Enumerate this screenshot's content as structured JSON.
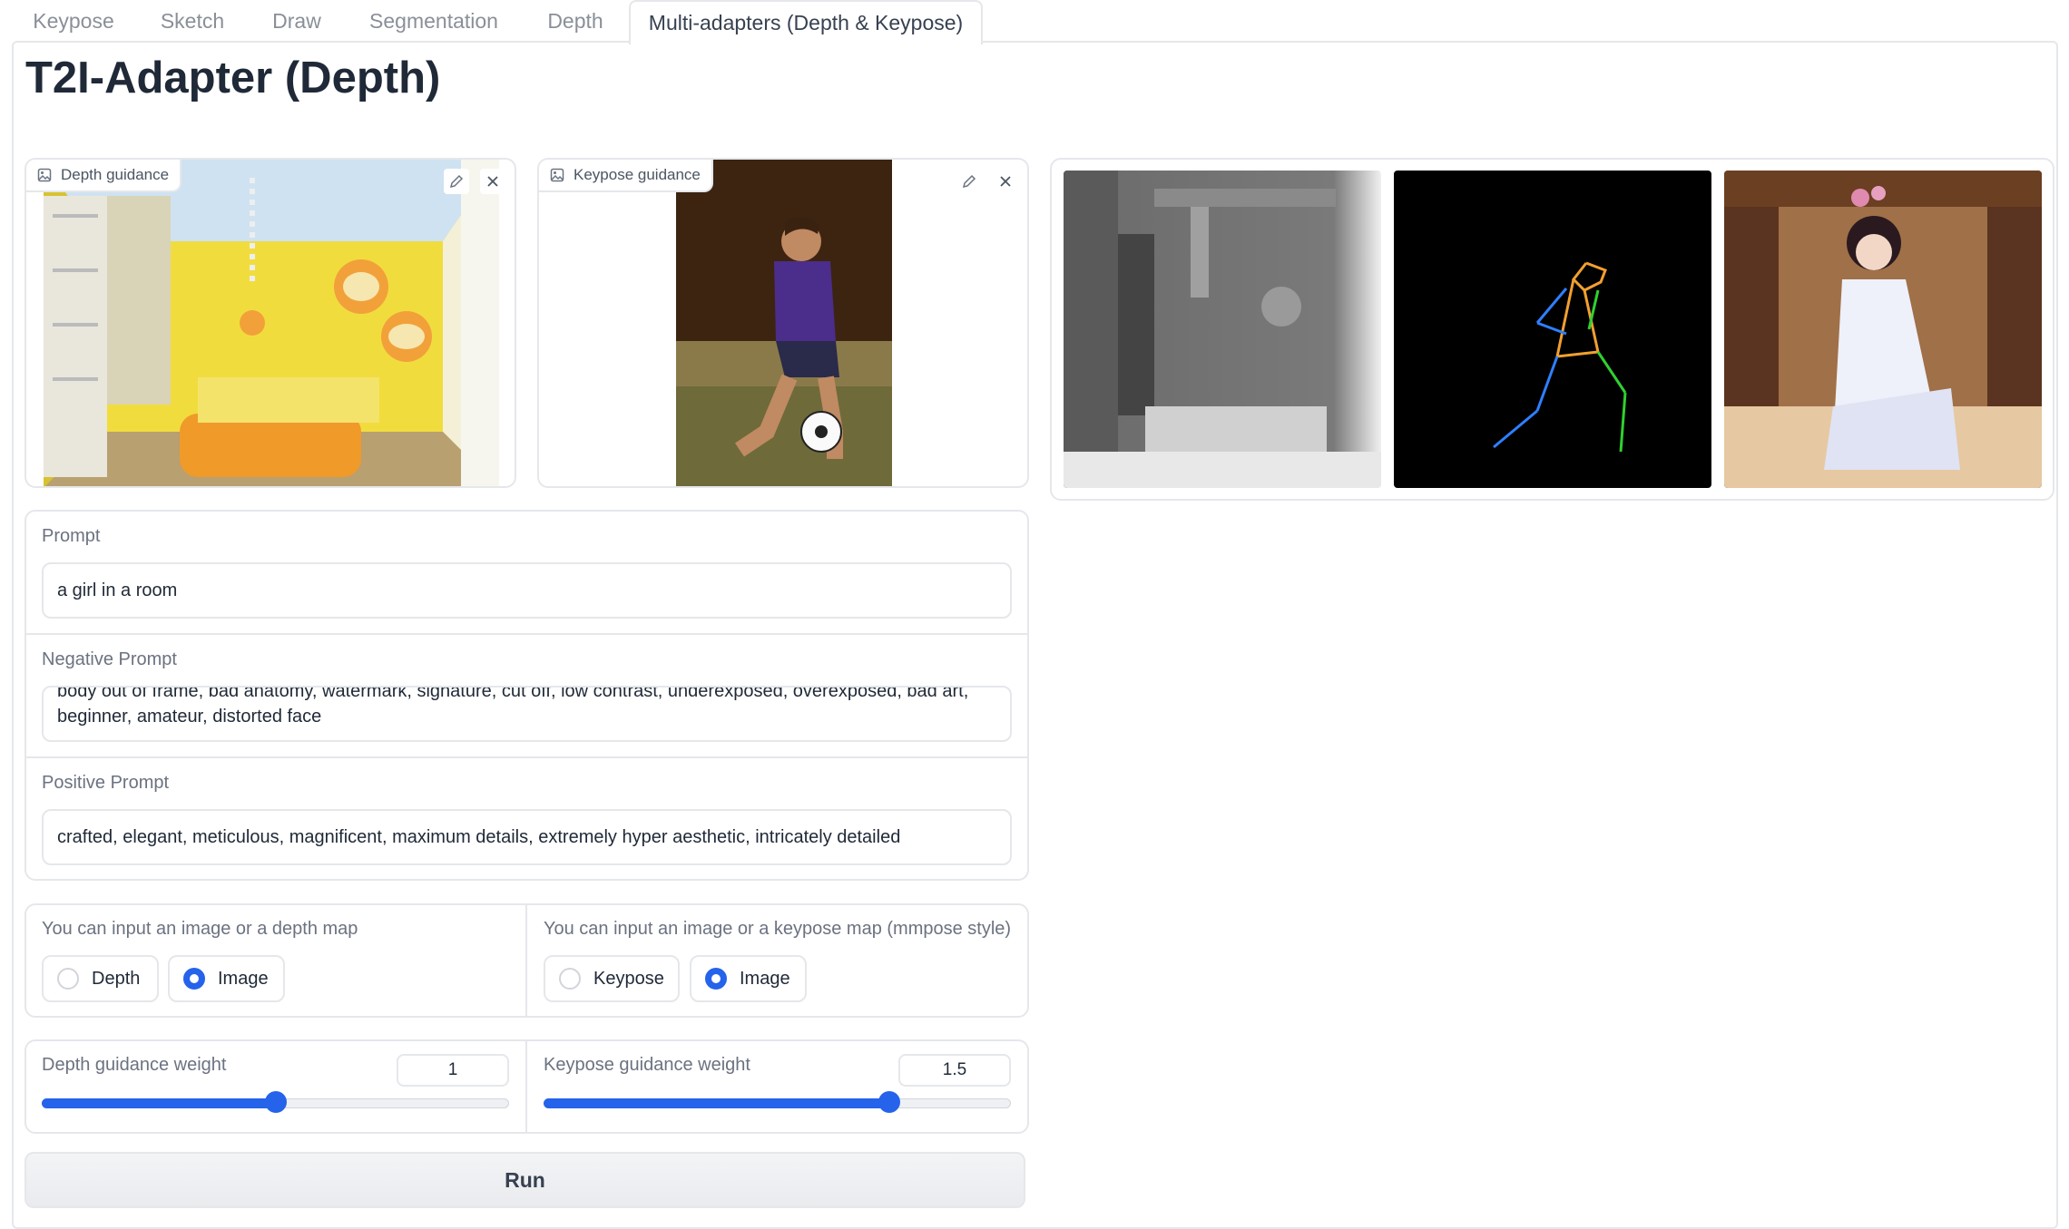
{
  "tabs": [
    "Keypose",
    "Sketch",
    "Draw",
    "Segmentation",
    "Depth",
    "Multi-adapters (Depth & Keypose)"
  ],
  "title": "T2I-Adapter (Depth)",
  "depth_image": {
    "label": "Depth guidance"
  },
  "keypose_image": {
    "label": "Keypose guidance"
  },
  "prompt": {
    "label": "Prompt",
    "value": "a girl in a room"
  },
  "negative_prompt": {
    "label": "Negative Prompt",
    "line1": "body out of frame, bad anatomy, watermark, signature, cut off, low contrast, underexposed, overexposed, bad art,",
    "line2": "beginner, amateur, distorted face"
  },
  "positive_prompt": {
    "label": "Positive Prompt",
    "value": "crafted, elegant, meticulous, magnificent, maximum details, extremely hyper aesthetic, intricately detailed"
  },
  "depth_input_type": {
    "label": "You can input an image or a depth map",
    "options": [
      "Depth",
      "Image"
    ],
    "selected": "Image"
  },
  "keypose_input_type": {
    "label": "You can input an image or a keypose map (mmpose style)",
    "options": [
      "Keypose",
      "Image"
    ],
    "selected": "Image"
  },
  "depth_weight": {
    "label": "Depth guidance weight",
    "value": "1",
    "fraction": 0.5
  },
  "keypose_weight": {
    "label": "Keypose guidance weight",
    "value": "1.5",
    "fraction": 0.74
  },
  "run_label": "Run",
  "icons": {
    "image_label": "image-icon",
    "edit": "pencil-icon",
    "clear": "close-icon"
  },
  "colors": {
    "accent": "#2563eb",
    "border": "#e5e7eb"
  }
}
